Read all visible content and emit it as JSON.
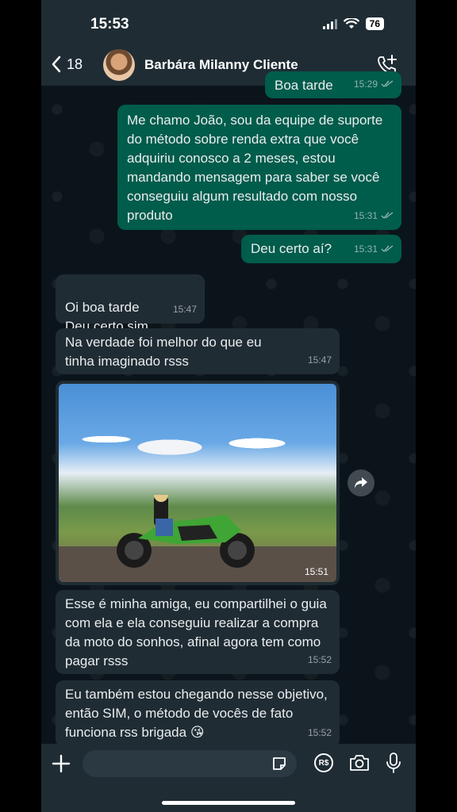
{
  "status_bar": {
    "time": "15:53",
    "battery": "76"
  },
  "header": {
    "back_count": "18",
    "contact_name": "Barbára Milanny Cliente"
  },
  "messages": [
    {
      "type": "out",
      "text": "Boa tarde",
      "time": "15:29"
    },
    {
      "type": "out",
      "text": "Me chamo João, sou da equipe de suporte do método sobre renda extra que você adquiriu conosco a 2 meses, estou mandando mensagem para saber se você conseguiu algum resultado com nosso produto",
      "time": "15:31"
    },
    {
      "type": "out",
      "text": "Deu certo aí?",
      "time": "15:31"
    },
    {
      "type": "in",
      "text": "Oi boa tarde\nDeu certo sim",
      "time": "15:47"
    },
    {
      "type": "in",
      "text": "Na verdade foi melhor do que eu tinha imaginado rsss",
      "time": "15:47"
    },
    {
      "type": "in-image",
      "time": "15:51"
    },
    {
      "type": "in",
      "text": "Esse é minha amiga, eu compartilhei o guia com ela e ela conseguiu realizar a compra da moto do sonhos, afinal agora tem como pagar rsss",
      "time": "15:52"
    },
    {
      "type": "in",
      "text": "Eu também estou chegando nesse objetivo, então SIM, o método de vocês de fato funciona rss brigada 😘",
      "time": "15:52"
    }
  ],
  "colors": {
    "outgoing": "#005c4b",
    "incoming": "#202c33",
    "header": "#1f2c34",
    "background": "#0b141a"
  }
}
